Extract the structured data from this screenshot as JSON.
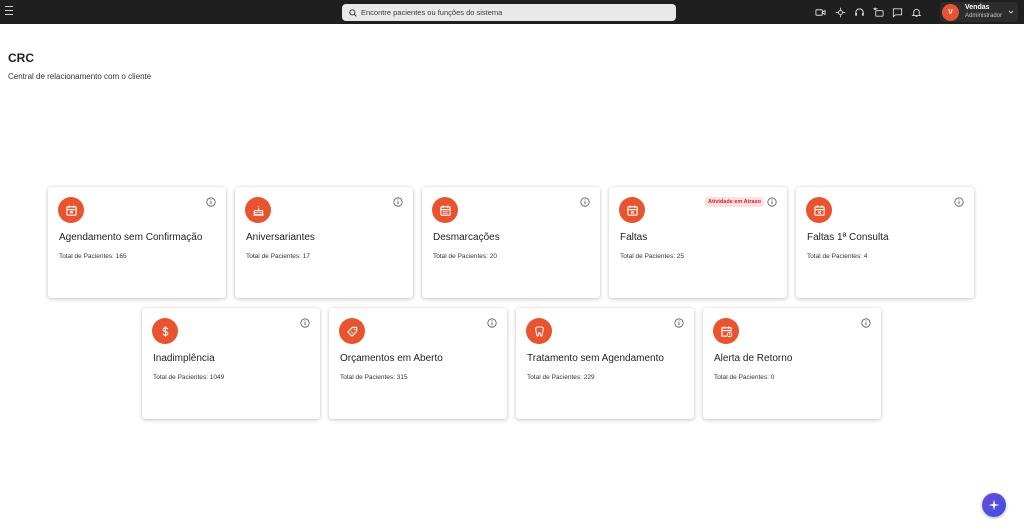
{
  "header": {
    "search_placeholder": "Encontre pacientes ou funções do sistema",
    "user": {
      "initial": "V",
      "name": "Vendas",
      "role": "Administrador"
    }
  },
  "page": {
    "title": "CRC",
    "subtitle": "Central de relacionamento com o cliente"
  },
  "colors": {
    "accent": "#e8542f",
    "topbar": "#1f1f1f",
    "badge_bg": "#fde1e1",
    "badge_text": "#d0222e",
    "fab": "#5b4ee0"
  },
  "cards": [
    {
      "title": "Agendamento sem Confirmação",
      "count": "Total de Pacientes: 165",
      "icon": "calendar-icon"
    },
    {
      "title": "Aniversariantes",
      "count": "Total de Pacientes: 17",
      "icon": "cake-icon"
    },
    {
      "title": "Desmarcações",
      "count": "Total de Pacientes: 20",
      "icon": "calendar-grid-icon"
    },
    {
      "title": "Faltas",
      "count": "Total de Pacientes: 25",
      "icon": "calendar-x-icon",
      "badge": "Atividade em Atraso"
    },
    {
      "title": "Faltas 1ª Consulta",
      "count": "Total de Pacientes: 4",
      "icon": "calendar-x-icon"
    },
    {
      "title": "Inadimplência",
      "count": "Total de Pacientes: 1049",
      "icon": "dollar-icon"
    },
    {
      "title": "Orçamentos em Aberto",
      "count": "Total de Pacientes: 315",
      "icon": "tag-icon"
    },
    {
      "title": "Tratamento sem Agendamento",
      "count": "Total de Pacientes: 229",
      "icon": "tooth-icon"
    },
    {
      "title": "Alerta de Retorno",
      "count": "Total de Pacientes: 0",
      "icon": "calendar-clock-icon"
    }
  ]
}
